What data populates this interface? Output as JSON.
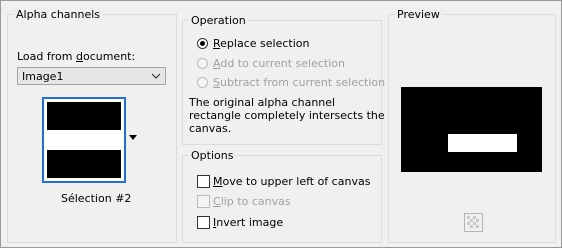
{
  "alpha_channels": {
    "title": "Alpha channels",
    "load_from_label_prefix": "Load from ",
    "load_from_label_underlined": "d",
    "load_from_label_suffix": "ocument:",
    "document_selected": "Image1",
    "thumbnail_caption": "Sélection #2"
  },
  "operation": {
    "title": "Operation",
    "options": [
      {
        "hot": "R",
        "rest": "eplace selection",
        "checked": true,
        "enabled": true
      },
      {
        "hot": "A",
        "rest": "dd to current selection",
        "checked": false,
        "enabled": false
      },
      {
        "hot": "S",
        "rest": "ubtract from current selection",
        "checked": false,
        "enabled": false
      }
    ],
    "message_line1": "The original alpha channel",
    "message_line2": "rectangle completely intersects the",
    "message_line3": "canvas."
  },
  "options": {
    "title": "Options",
    "items": [
      {
        "hot": "M",
        "rest": "ove to upper left of canvas",
        "checked": false,
        "enabled": true
      },
      {
        "hot": "C",
        "rest": "lip to canvas",
        "checked": false,
        "enabled": false
      },
      {
        "hot": "I",
        "rest": "nvert image",
        "checked": false,
        "enabled": true
      }
    ]
  },
  "preview": {
    "title": "Preview"
  }
}
